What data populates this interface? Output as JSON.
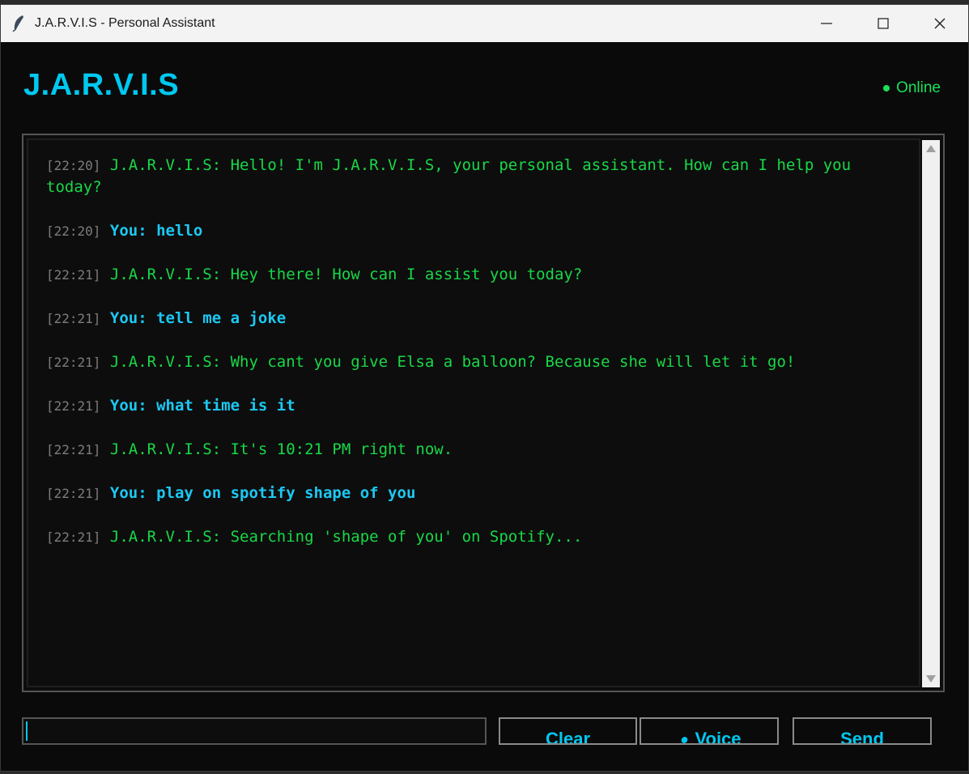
{
  "window": {
    "title": "J.A.R.V.I.S - Personal Assistant",
    "icon": "feather-icon"
  },
  "header": {
    "app_title": "J.A.R.V.I.S",
    "status": "Online",
    "status_color": "#19e05a",
    "accent_color": "#00c8f0"
  },
  "chat": {
    "messages": [
      {
        "time": "[22:20]",
        "sender": "bot",
        "text": "J.A.R.V.I.S: Hello! I'm J.A.R.V.I.S, your personal assistant. How can I help you today?"
      },
      {
        "time": "[22:20]",
        "sender": "user",
        "text": "You: hello"
      },
      {
        "time": "[22:21]",
        "sender": "bot",
        "text": "J.A.R.V.I.S: Hey there! How can I assist you today?"
      },
      {
        "time": "[22:21]",
        "sender": "user",
        "text": "You: tell me a joke"
      },
      {
        "time": "[22:21]",
        "sender": "bot",
        "text": "J.A.R.V.I.S: Why cant you give Elsa a balloon? Because she will let it go!"
      },
      {
        "time": "[22:21]",
        "sender": "user",
        "text": "You: what time is it"
      },
      {
        "time": "[22:21]",
        "sender": "bot",
        "text": "J.A.R.V.I.S: It's 10:21 PM right now."
      },
      {
        "time": "[22:21]",
        "sender": "user",
        "text": "You: play on spotify shape of you"
      },
      {
        "time": "[22:21]",
        "sender": "bot",
        "text": "J.A.R.V.I.S: Searching 'shape of you' on Spotify..."
      }
    ]
  },
  "input": {
    "value": "",
    "placeholder": ""
  },
  "buttons": {
    "clear": "Clear",
    "voice": "Voice",
    "voice_icon": "microphone-icon",
    "send": "Send"
  }
}
